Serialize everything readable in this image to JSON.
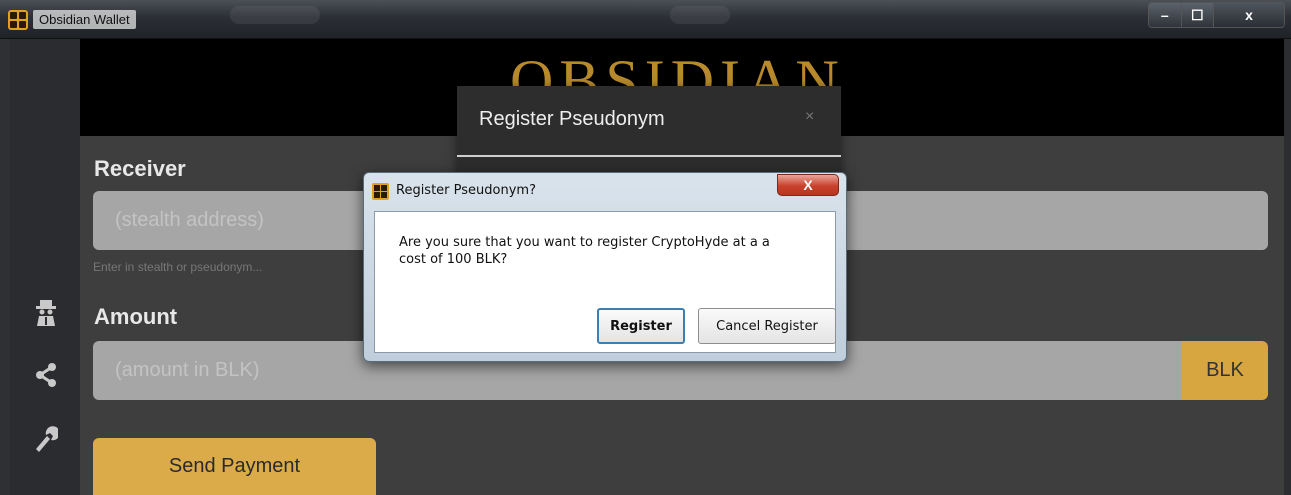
{
  "window": {
    "title": "Obsidian Wallet",
    "controls": {
      "minimize": "–",
      "maximize": "☐",
      "close": "x"
    }
  },
  "banner": {
    "logo_text": "OBSIDIAN"
  },
  "sidebar": {
    "icons": [
      "spy-icon",
      "share-icon",
      "wrench-icon"
    ]
  },
  "form": {
    "receiver": {
      "label": "Receiver",
      "placeholder": "(stealth address)",
      "hint": "Enter in stealth or pseudonym..."
    },
    "amount": {
      "label": "Amount",
      "placeholder": "(amount in BLK)",
      "unit": "BLK"
    },
    "send_button": "Send Payment"
  },
  "modal": {
    "title": "Register Pseudonym",
    "close": "×"
  },
  "dialog": {
    "title": "Register Pseudonym?",
    "close": "X",
    "message": "Are you sure that you want to register CryptoHyde at a a cost of 100 BLK?",
    "buttons": {
      "confirm": "Register",
      "cancel": "Cancel Register"
    }
  },
  "colors": {
    "accent": "#dcab49",
    "background": "#3e3e3e",
    "sidebar": "#2b2c2f",
    "field": "#a6a6a6"
  }
}
